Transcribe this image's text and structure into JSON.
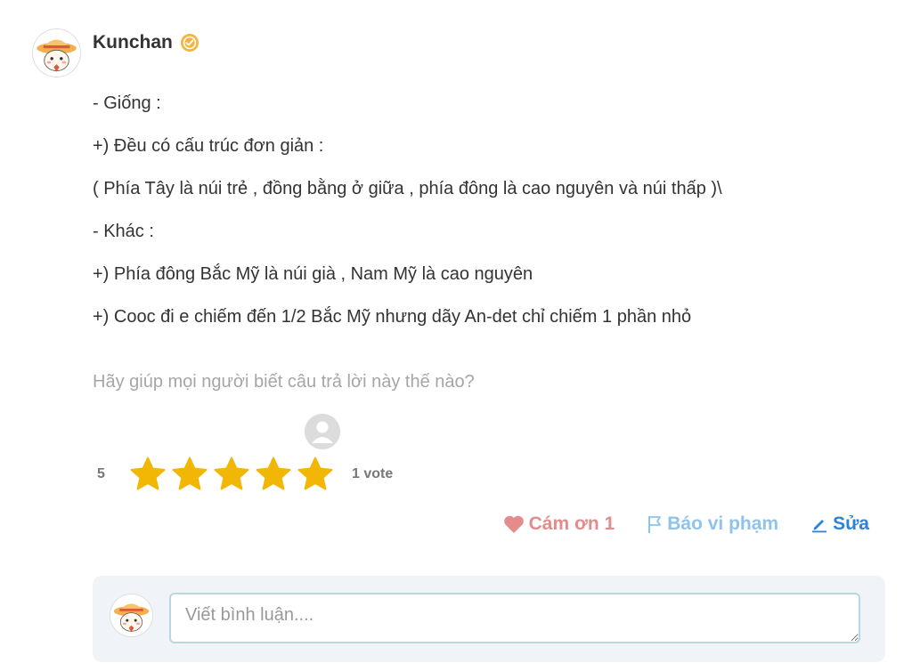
{
  "author": {
    "name": "Kunchan",
    "avatar_icon": "straw-hat-cat-avatar",
    "badge_icon": "verified-badge-icon"
  },
  "answer": {
    "lines": [
      "- Giống :",
      "+) Đều có cấu trúc đơn giản :",
      "( Phía Tây là núi trẻ , đồng bằng ở giữa , phía đông là cao nguyên và núi thấp )\\",
      "- Khác :",
      "+) Phía đông Bắc Mỹ là núi già , Nam Mỹ là cao nguyên",
      "+) Cooc đi e chiếm đến 1/2 Bắc Mỹ nhưng dãy An-det chỉ chiếm 1 phần nhỏ"
    ]
  },
  "feedback": {
    "prompt": "Hãy giúp mọi người biết câu trả lời này thế nào?"
  },
  "rating": {
    "value": "5",
    "stars_filled": 5,
    "stars_total": 5,
    "vote_count": "1 vote",
    "star_color": "#f2b705"
  },
  "actions": {
    "thanks_label": "Cám ơn 1",
    "report_label": "Báo vi phạm",
    "edit_label": "Sửa",
    "thanks_color": "#e48b8b",
    "report_color": "#8ec3ee",
    "edit_color": "#2b82d9"
  },
  "comment": {
    "placeholder": "Viết bình luận....",
    "value": ""
  }
}
